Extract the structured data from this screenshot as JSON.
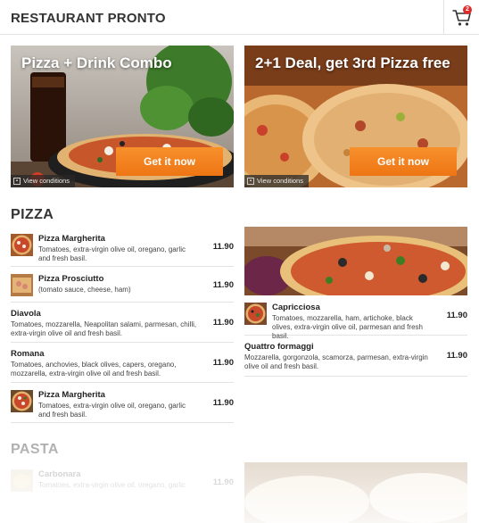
{
  "header": {
    "brand": "RESTAURANT PRONTO",
    "cart_count": "2"
  },
  "promos": [
    {
      "title": "Pizza + Drink Combo",
      "button": "Get it now",
      "conditions": "View conditions"
    },
    {
      "title": "2+1 Deal, get 3rd Pizza free",
      "button": "Get it now",
      "conditions": "View conditions"
    }
  ],
  "sections": {
    "pizza": "PIZZA",
    "pasta": "PASTA"
  },
  "pizza_left": [
    {
      "name": "Pizza Margherita",
      "desc": "Tomatoes, extra-virgin olive oil, oregano, garlic and fresh basil.",
      "price": "11.90"
    },
    {
      "name": "Pizza Prosciutto",
      "desc": "(tomato sauce, cheese, ham)",
      "price": "11.90"
    },
    {
      "name": "Diavola",
      "desc": "Tomatoes, mozzarella, Neapolitan salami, parmesan, chilli, extra-virgin olive oil and fresh basil.",
      "price": "11.90"
    },
    {
      "name": "Romana",
      "desc": "Tomatoes, anchovies, black olives, capers, oregano, mozzarella, extra-virgin olive oil and fresh basil.",
      "price": "11.90"
    },
    {
      "name": "Pizza Margherita",
      "desc": "Tomatoes, extra-virgin olive oil, oregano, garlic and fresh basil.",
      "price": "11.90"
    }
  ],
  "pizza_right": [
    {
      "name": "Capricciosa",
      "desc": "Tomatoes, mozzarella, ham, artichoke, black olives, extra-virgin olive oil, parmesan and fresh basil.",
      "price": "11.90"
    },
    {
      "name": "Quattro formaggi",
      "desc": "Mozzarella, gorgonzola, scamorza, parmesan, extra-virgin olive oil and fresh basil.",
      "price": "11.90"
    }
  ],
  "pasta_left": [
    {
      "name": "Carbonara",
      "desc": "Tomatoes, extra-virgin olive oil, oregano, garlic",
      "price": "11.90"
    }
  ],
  "colors": {
    "accent": "#f08a22",
    "badge": "#e02b2b"
  }
}
